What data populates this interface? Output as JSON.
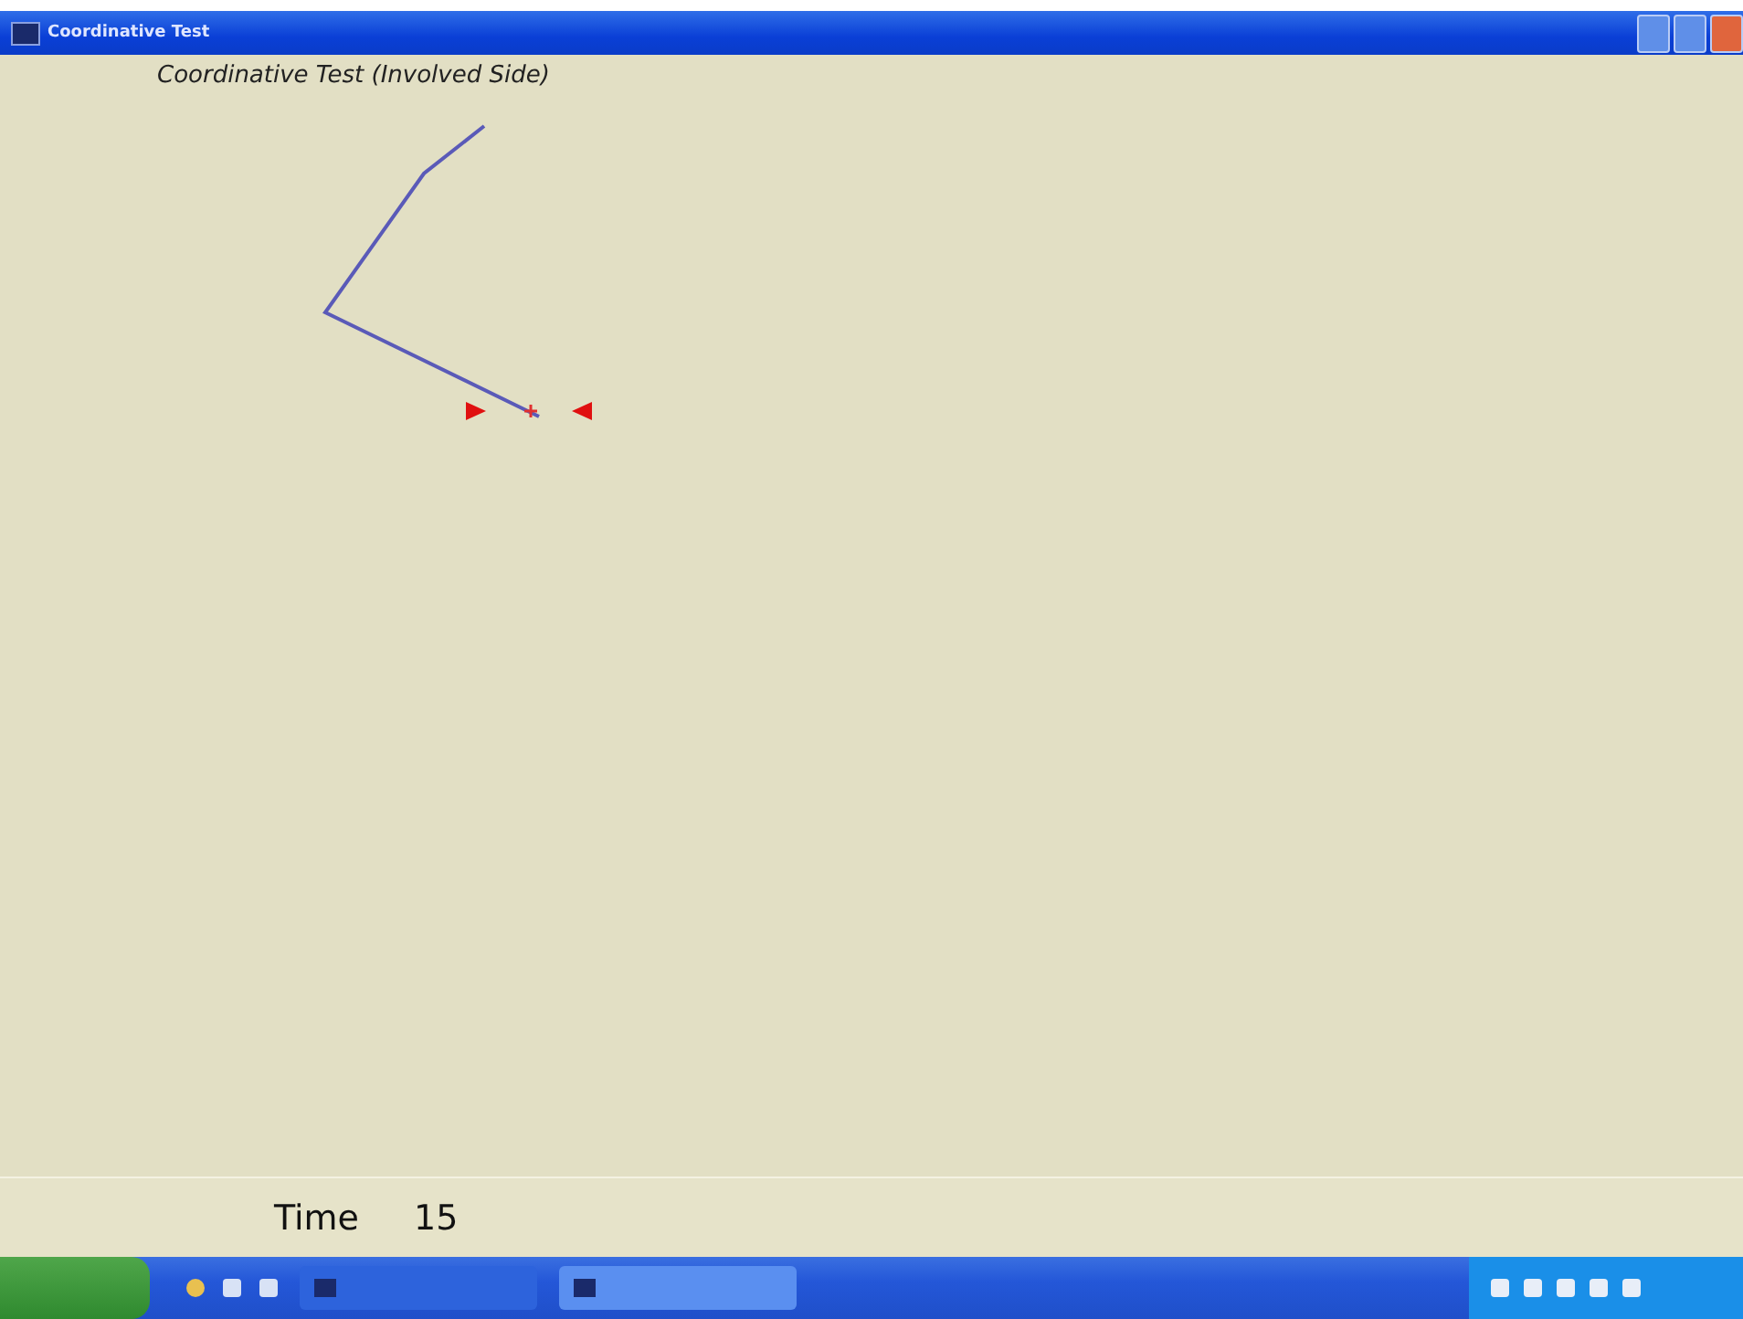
{
  "window": {
    "title": "Coordinative Test"
  },
  "heading": "Coordinative Test (Involved Side)",
  "footer": {
    "label": "Time",
    "value": "15"
  },
  "taskbar": {
    "tasks": [
      {
        "selected": false
      },
      {
        "selected": true
      }
    ]
  }
}
